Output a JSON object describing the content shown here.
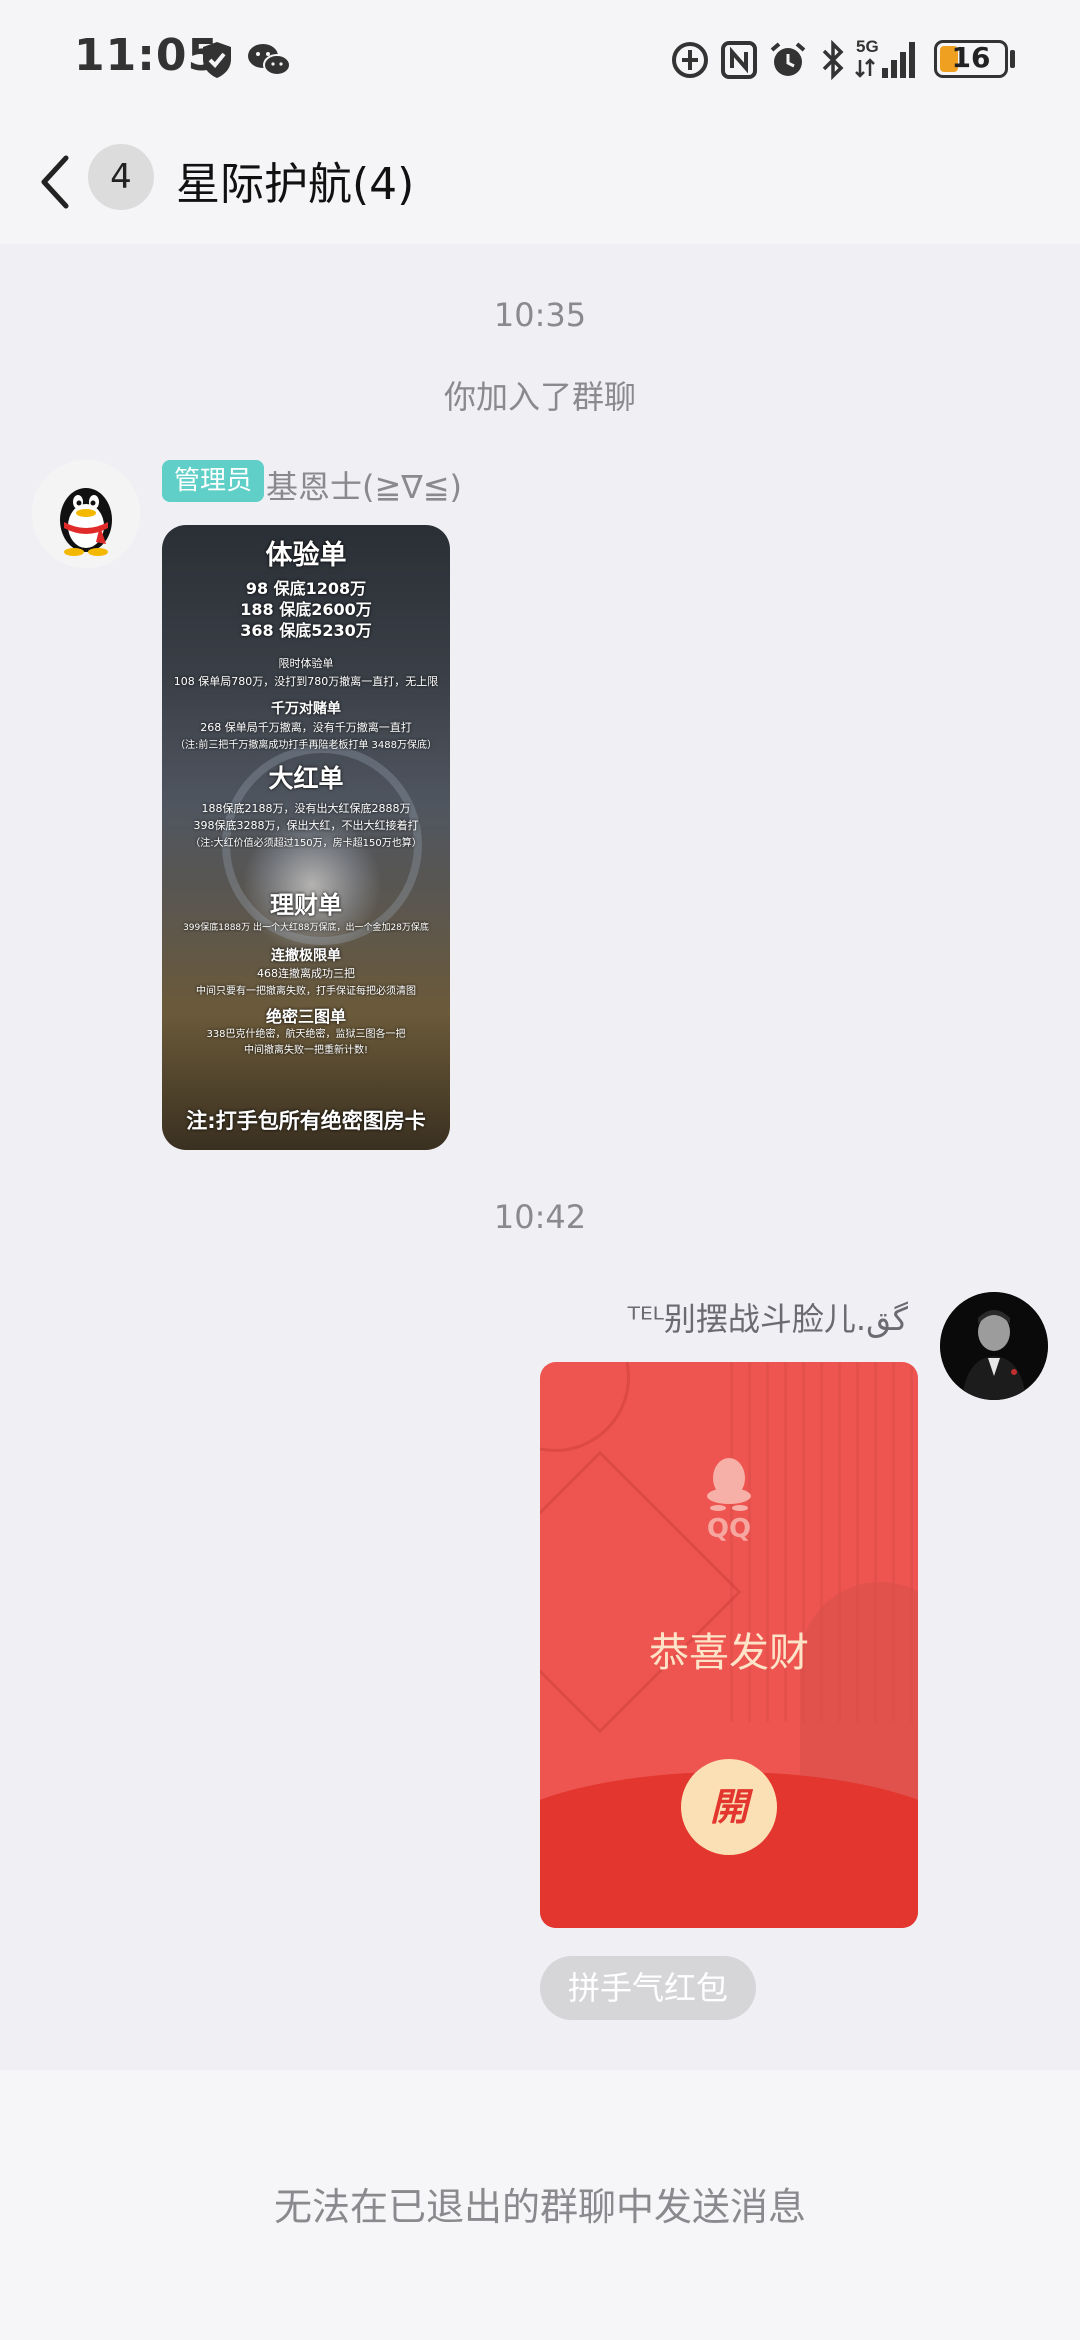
{
  "status_bar": {
    "time": "11:05",
    "network": "5G",
    "battery": "16",
    "battery_level_percent": 16,
    "icons": [
      "shield-check-icon",
      "wechat-icon",
      "data-saver-icon",
      "nfc-icon",
      "alarm-icon",
      "bluetooth-icon",
      "signal-5g-icon",
      "battery-icon"
    ]
  },
  "header": {
    "back_icon": "chevron-left-icon",
    "unread_count": "4",
    "title": "星际护航(4)"
  },
  "messages": {
    "ts1": "10:35",
    "system_join": "你加入了群聊",
    "admin_message": {
      "role_tag": "管理员",
      "sender": "基恩士(≧∇≦)",
      "poster_lines": [
        "体验单",
        "98 保底1208万",
        "188 保底2600万",
        "368 保底5230万",
        "限时体验单",
        "108 保单局780万，没打到780万撤离一直打，无上限",
        "千万对赌单",
        "268 保单局千万撤离，没有千万撤离一直打",
        "（注:前三把千万撤离成功打手再陪老板打单 3488万保底）",
        "大红单",
        "188保底2188万，没有出大红保底2888万",
        "398保底3288万，保出大红，不出大红接着打",
        "（注:大红价值必须超过150万，房卡超150万也算）",
        "理财单",
        "399保底1888万 出一个大红88万保底，出一个金加28万保底",
        "连撤极限单",
        "468连撤离成功三把",
        "中间只要有一把撤离失败，打手保证每把必须清图",
        "绝密三图单",
        "338巴克什绝密，航天绝密，监狱三图各一把",
        "中间撤离失败一把重新计数!",
        "注:打手包所有绝密图房卡"
      ]
    },
    "ts2": "10:42",
    "red_packet_message": {
      "sender": "ᵀᴱᴸ别摆战斗脸儿.گق",
      "brand": "QQ",
      "greeting": "恭喜发财",
      "open_label": "開",
      "packet_type": "拼手气红包"
    }
  },
  "footer": {
    "notice": "无法在已退出的群聊中发送消息"
  },
  "colors": {
    "background": "#efeff4",
    "red_packet": "#ee5550",
    "red_packet_dark": "#e2362f",
    "admin_tag": "#5fcfc8",
    "open_button": "#fbe0b5"
  }
}
